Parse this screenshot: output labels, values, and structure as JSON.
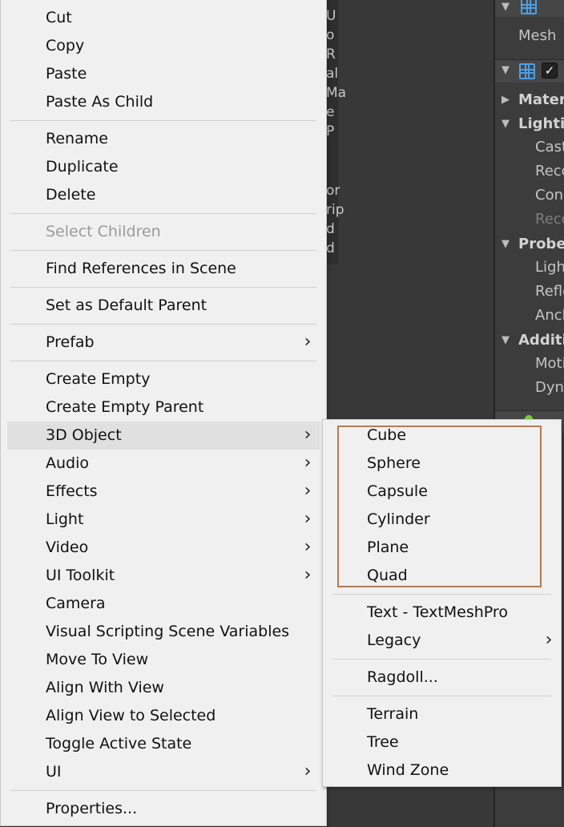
{
  "background": {
    "hierarchy_fragments": [
      "U",
      "o",
      "R",
      "al",
      "Ma",
      "e",
      "P",
      "or",
      "rip",
      "d",
      "d"
    ],
    "inspector": {
      "mesh_label": "Mesh",
      "rows": [
        {
          "label": "Materi",
          "style": "bold",
          "toggle": "collapsed"
        },
        {
          "label": "Lightir",
          "style": "bold",
          "toggle": "expanded"
        },
        {
          "label": "Cast",
          "style": "normal"
        },
        {
          "label": "Reco",
          "style": "normal"
        },
        {
          "label": "Con",
          "style": "normal"
        },
        {
          "label": "Reco",
          "style": "dim"
        },
        {
          "label": "Probes",
          "style": "bold",
          "toggle": "expanded"
        },
        {
          "label": "Ligh",
          "style": "normal"
        },
        {
          "label": "Refle",
          "style": "normal"
        },
        {
          "label": "Anch",
          "style": "normal"
        },
        {
          "label": "Additi",
          "style": "bold",
          "toggle": "expanded"
        },
        {
          "label": "Moti",
          "style": "normal"
        },
        {
          "label": "Dyn",
          "style": "normal"
        }
      ]
    }
  },
  "context_menu": {
    "items": [
      {
        "label": "Cut"
      },
      {
        "label": "Copy"
      },
      {
        "label": "Paste"
      },
      {
        "label": "Paste As Child"
      },
      {
        "separator": true
      },
      {
        "label": "Rename"
      },
      {
        "label": "Duplicate"
      },
      {
        "label": "Delete"
      },
      {
        "separator": true
      },
      {
        "label": "Select Children",
        "disabled": true
      },
      {
        "separator": true
      },
      {
        "label": "Find References in Scene"
      },
      {
        "separator": true
      },
      {
        "label": "Set as Default Parent"
      },
      {
        "separator": true
      },
      {
        "label": "Prefab",
        "submenu": true
      },
      {
        "separator": true
      },
      {
        "label": "Create Empty"
      },
      {
        "label": "Create Empty Parent"
      },
      {
        "label": "3D Object",
        "submenu": true,
        "highlighted": true
      },
      {
        "label": "Audio",
        "submenu": true
      },
      {
        "label": "Effects",
        "submenu": true
      },
      {
        "label": "Light",
        "submenu": true
      },
      {
        "label": "Video",
        "submenu": true
      },
      {
        "label": "UI Toolkit",
        "submenu": true
      },
      {
        "label": "Camera"
      },
      {
        "label": "Visual Scripting Scene Variables"
      },
      {
        "label": "Move To View"
      },
      {
        "label": "Align With View"
      },
      {
        "label": "Align View to Selected"
      },
      {
        "label": "Toggle Active State"
      },
      {
        "label": "UI",
        "submenu": true
      },
      {
        "separator": true
      },
      {
        "label": "Properties..."
      }
    ]
  },
  "submenu_3d_object": {
    "items": [
      {
        "label": "Cube"
      },
      {
        "label": "Sphere"
      },
      {
        "label": "Capsule"
      },
      {
        "label": "Cylinder"
      },
      {
        "label": "Plane"
      },
      {
        "label": "Quad"
      },
      {
        "separator": true
      },
      {
        "label": "Text - TextMeshPro"
      },
      {
        "label": "Legacy",
        "submenu": true
      },
      {
        "separator": true
      },
      {
        "label": "Ragdoll..."
      },
      {
        "separator": true
      },
      {
        "label": "Terrain"
      },
      {
        "label": "Tree"
      },
      {
        "label": "Wind Zone"
      }
    ],
    "highlight_color": "#b37a55"
  },
  "icons": {
    "submenu_arrow": "›",
    "collapsed_triangle": "▶",
    "expanded_triangle": "▼",
    "checkmark": "✓"
  }
}
